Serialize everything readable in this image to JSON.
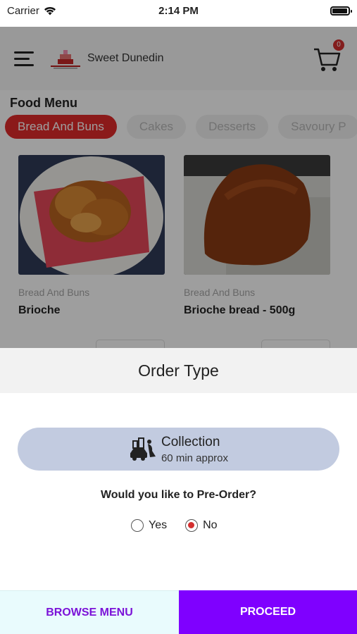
{
  "status_bar": {
    "carrier": "Carrier",
    "time": "2:14 PM"
  },
  "header": {
    "title": "Sweet Dunedin",
    "cart_count": "0"
  },
  "menu": {
    "section_title": "Food Menu",
    "categories": [
      "Bread And Buns",
      "Cakes",
      "Desserts",
      "Savoury P"
    ],
    "active_category": "Bread And Buns"
  },
  "products": [
    {
      "category": "Bread And Buns",
      "name": "Brioche"
    },
    {
      "category": "Bread And Buns",
      "name": "Brioche bread - 500g"
    }
  ],
  "order_type_sheet": {
    "title": "Order Type",
    "option": {
      "label": "Collection",
      "subtext": "60 min approx"
    },
    "preorder_question": "Would you like to Pre-Order?",
    "radio_options": [
      {
        "label": "Yes",
        "checked": false
      },
      {
        "label": "No",
        "checked": true
      }
    ]
  },
  "actions": {
    "browse_label": "BROWSE MENU",
    "proceed_label": "PROCEED"
  },
  "colors": {
    "accent_red": "#e02a2a",
    "proceed_purple": "#7f00ff",
    "browse_text": "#7b12d8",
    "pill_bg": "#c2cbe0"
  },
  "icons": [
    "wifi-icon",
    "battery-icon",
    "menu-icon",
    "logo",
    "cart-icon",
    "delivery-collection-icon"
  ]
}
